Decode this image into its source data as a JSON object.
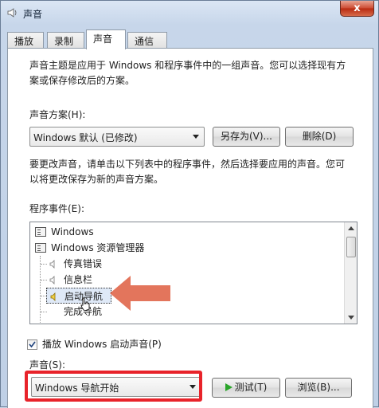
{
  "window": {
    "title": "声音",
    "close_label": "x"
  },
  "tabs": [
    {
      "label": "播放",
      "active": false
    },
    {
      "label": "录制",
      "active": false
    },
    {
      "label": "声音",
      "active": true
    },
    {
      "label": "通信",
      "active": false
    }
  ],
  "intro": {
    "line1": "声音主题是应用于 Windows 和程序事件中的一组声音。您可以选择现有方",
    "line2": "案或保存修改后的方案。"
  },
  "scheme": {
    "label": "声音方案(H):",
    "selected": "Windows 默认 (已修改)",
    "save_as_label": "另存为(V)...",
    "delete_label": "删除(D)"
  },
  "change_hint": {
    "line1": "要更改声音，请单击以下列表中的程序事件，然后选择要应用的声音。您可",
    "line2": "以将更改保存为新的声音方案。"
  },
  "events": {
    "label": "程序事件(E):",
    "items": [
      {
        "label": "Windows",
        "type": "group"
      },
      {
        "label": "Windows 资源管理器",
        "type": "group"
      },
      {
        "label": "传真错误",
        "type": "sound"
      },
      {
        "label": "信息栏",
        "type": "sound"
      },
      {
        "label": "启动导航",
        "type": "sound-selected"
      },
      {
        "label": "完成导航",
        "type": "sound"
      }
    ]
  },
  "startup": {
    "label": "播放 Windows 启动声音(P)",
    "checked": true
  },
  "sound": {
    "label": "声音(S):",
    "selected": "Windows 导航开始",
    "test_label": "测试(T)",
    "browse_label": "浏览(B)..."
  },
  "colors": {
    "highlight_red": "#e8232a",
    "arrow_orange": "#e0664a"
  }
}
